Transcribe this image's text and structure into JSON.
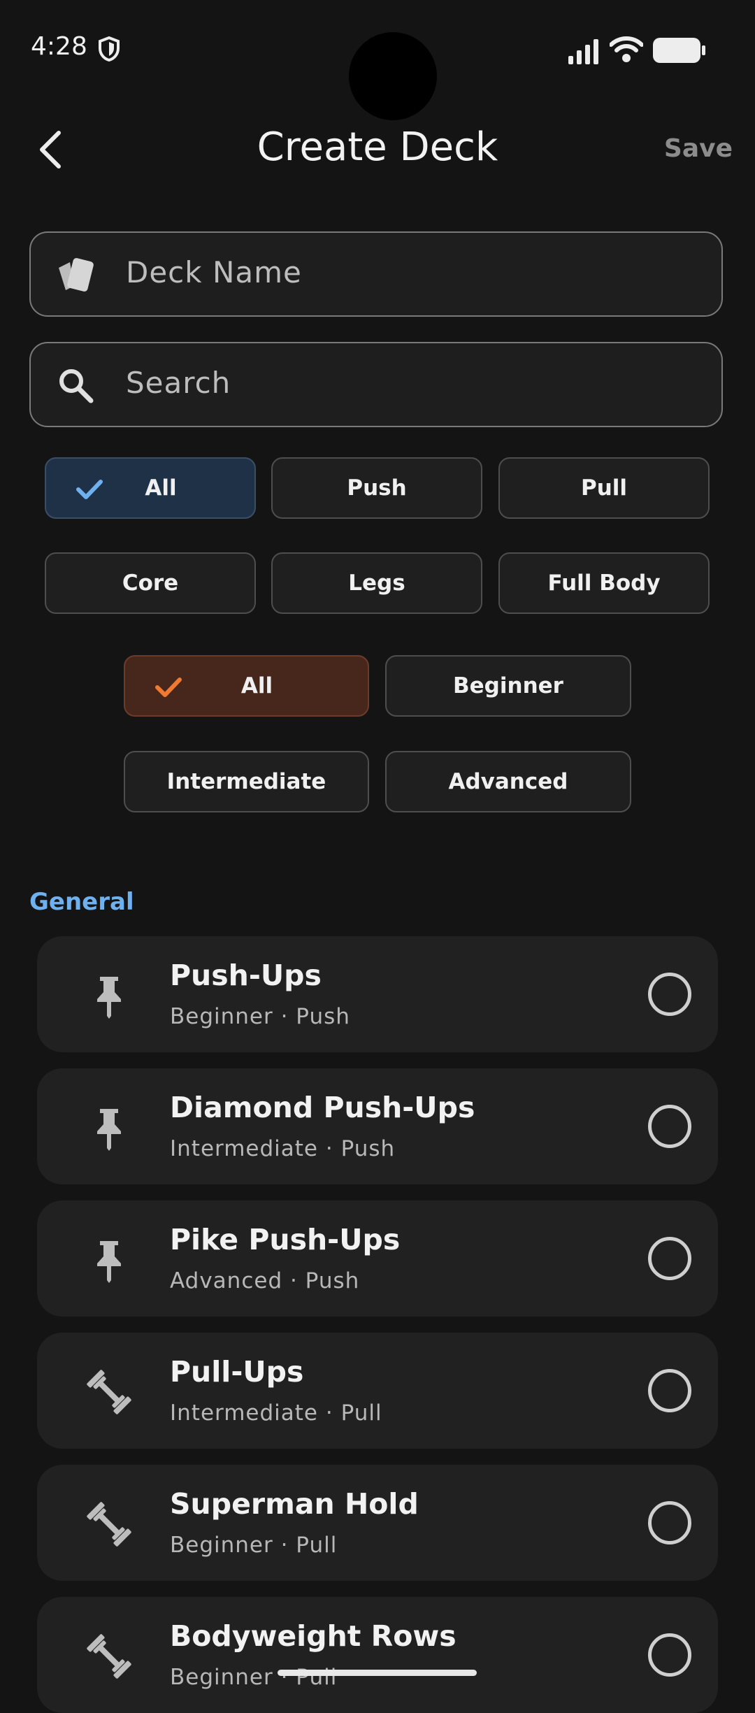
{
  "status_bar": {
    "time": "4:28"
  },
  "header": {
    "title": "Create Deck",
    "save_label": "Save"
  },
  "deck_name": {
    "placeholder": "Deck Name"
  },
  "search": {
    "placeholder": "Search"
  },
  "category_filters": [
    {
      "label": "All",
      "selected": true
    },
    {
      "label": "Push",
      "selected": false
    },
    {
      "label": "Pull",
      "selected": false
    },
    {
      "label": "Core",
      "selected": false
    },
    {
      "label": "Legs",
      "selected": false
    },
    {
      "label": "Full Body",
      "selected": false
    }
  ],
  "level_filters": [
    {
      "label": "All",
      "selected": true
    },
    {
      "label": "Beginner",
      "selected": false
    },
    {
      "label": "Intermediate",
      "selected": false
    },
    {
      "label": "Advanced",
      "selected": false
    }
  ],
  "section": {
    "label": "General"
  },
  "exercises": [
    {
      "name": "Push-Ups",
      "meta": "Beginner · Push",
      "icon": "pushpin-icon"
    },
    {
      "name": "Diamond Push-Ups",
      "meta": "Intermediate · Push",
      "icon": "pushpin-icon"
    },
    {
      "name": "Pike Push-Ups",
      "meta": "Advanced · Push",
      "icon": "pushpin-icon"
    },
    {
      "name": "Pull-Ups",
      "meta": "Intermediate · Pull",
      "icon": "dumbbell-icon"
    },
    {
      "name": "Superman Hold",
      "meta": "Beginner · Pull",
      "icon": "dumbbell-icon"
    },
    {
      "name": "Bodyweight Rows",
      "meta": "Beginner · Pull",
      "icon": "dumbbell-icon"
    }
  ],
  "colors": {
    "background": "#141414",
    "accent_blue": "#6FB0EE",
    "accent_orange": "#F07A30",
    "selected_blue_chip": "#1F3146",
    "selected_orange_chip": "#47271C"
  }
}
